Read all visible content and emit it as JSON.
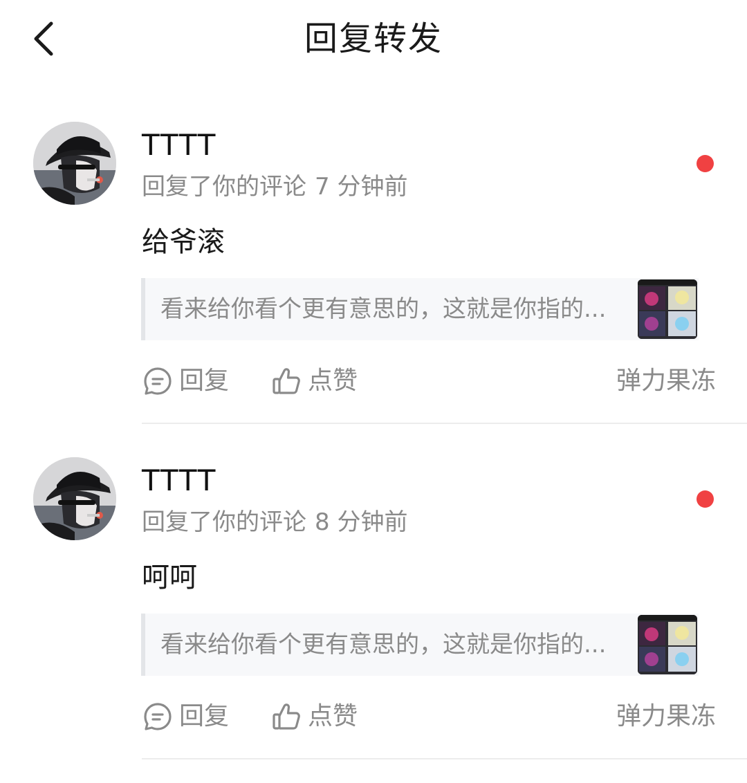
{
  "header": {
    "back_icon": "chevron-left-icon",
    "title": "回复转发"
  },
  "colors": {
    "unread_dot": "#f04142",
    "secondary_text": "#8a8a8a",
    "quote_background": "#f7f8fa"
  },
  "notifications": [
    {
      "username": "TTTT",
      "action_text": "回复了你的评论",
      "time": "7 分钟前",
      "reply": "给爷滚",
      "quoted_comment": "看来给你看个更有意思的，这就是你指的...",
      "actions": {
        "reply_label": "回复",
        "like_label": "点赞"
      },
      "source": "弹力果冻",
      "unread": true
    },
    {
      "username": "TTTT",
      "action_text": "回复了你的评论",
      "time": "8 分钟前",
      "reply": "呵呵",
      "quoted_comment": "看来给你看个更有意思的，这就是你指的...",
      "actions": {
        "reply_label": "回复",
        "like_label": "点赞"
      },
      "source": "弹力果冻",
      "unread": true
    }
  ]
}
